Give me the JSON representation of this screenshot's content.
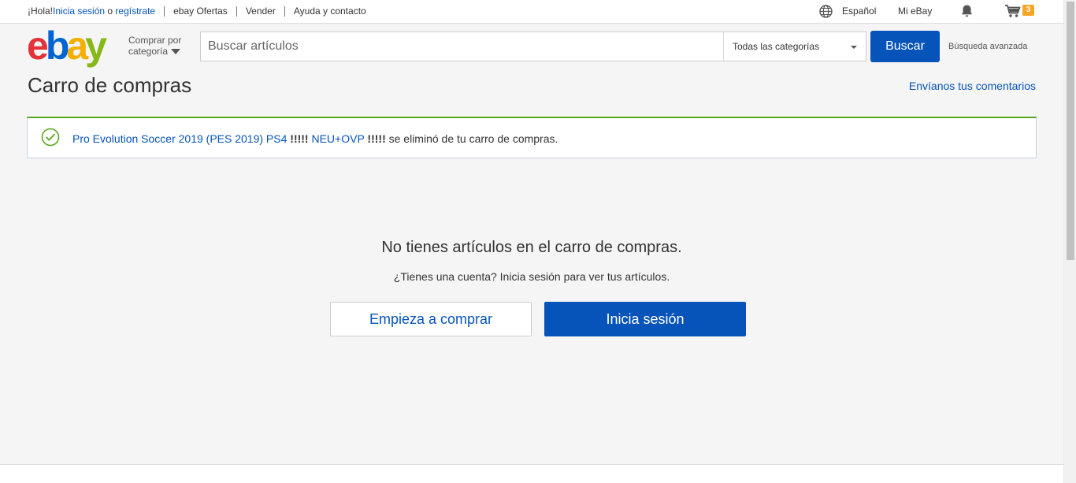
{
  "topbar": {
    "greeting": "¡Hola! ",
    "signin": "Inicia sesión",
    "or": " o ",
    "register": "regístrate",
    "deals": "ebay Ofertas",
    "sell": "Vender",
    "help": "Ayuda y contacto",
    "language": "Español",
    "my_ebay": "Mi eBay",
    "cart_count": "3"
  },
  "header": {
    "logo_letters": [
      "e",
      "b",
      "a",
      "y"
    ],
    "logo_colors": [
      "#e53238",
      "#0064d2",
      "#f5af02",
      "#86b817"
    ],
    "shop_by_line1": "Comprar por",
    "shop_by_line2": "categoría",
    "search_placeholder": "Buscar artículos",
    "category": "Todas las categorías",
    "search_button": "Buscar",
    "advanced": "Búsqueda avanzada"
  },
  "page": {
    "title": "Carro de compras",
    "feedback": "Envíanos tus comentarios"
  },
  "alert": {
    "item_part1": "Pro Evolution Soccer 2019 (PES 2019) PS4 ",
    "item_bang1": "!!!!!",
    "item_part2": " NEU+OVP ",
    "item_bang2": "!!!!!",
    "message": " se eliminó de tu carro de compras."
  },
  "empty": {
    "title": "No tienes artículos en el carro de compras.",
    "subtitle": "¿Tienes una cuenta? Inicia sesión para ver tus artículos.",
    "start_button": "Empieza a comprar",
    "signin_button": "Inicia sesión"
  },
  "colors": {
    "accent": "#0654ba",
    "success": "#5ba71b",
    "badge": "#f5a623"
  }
}
